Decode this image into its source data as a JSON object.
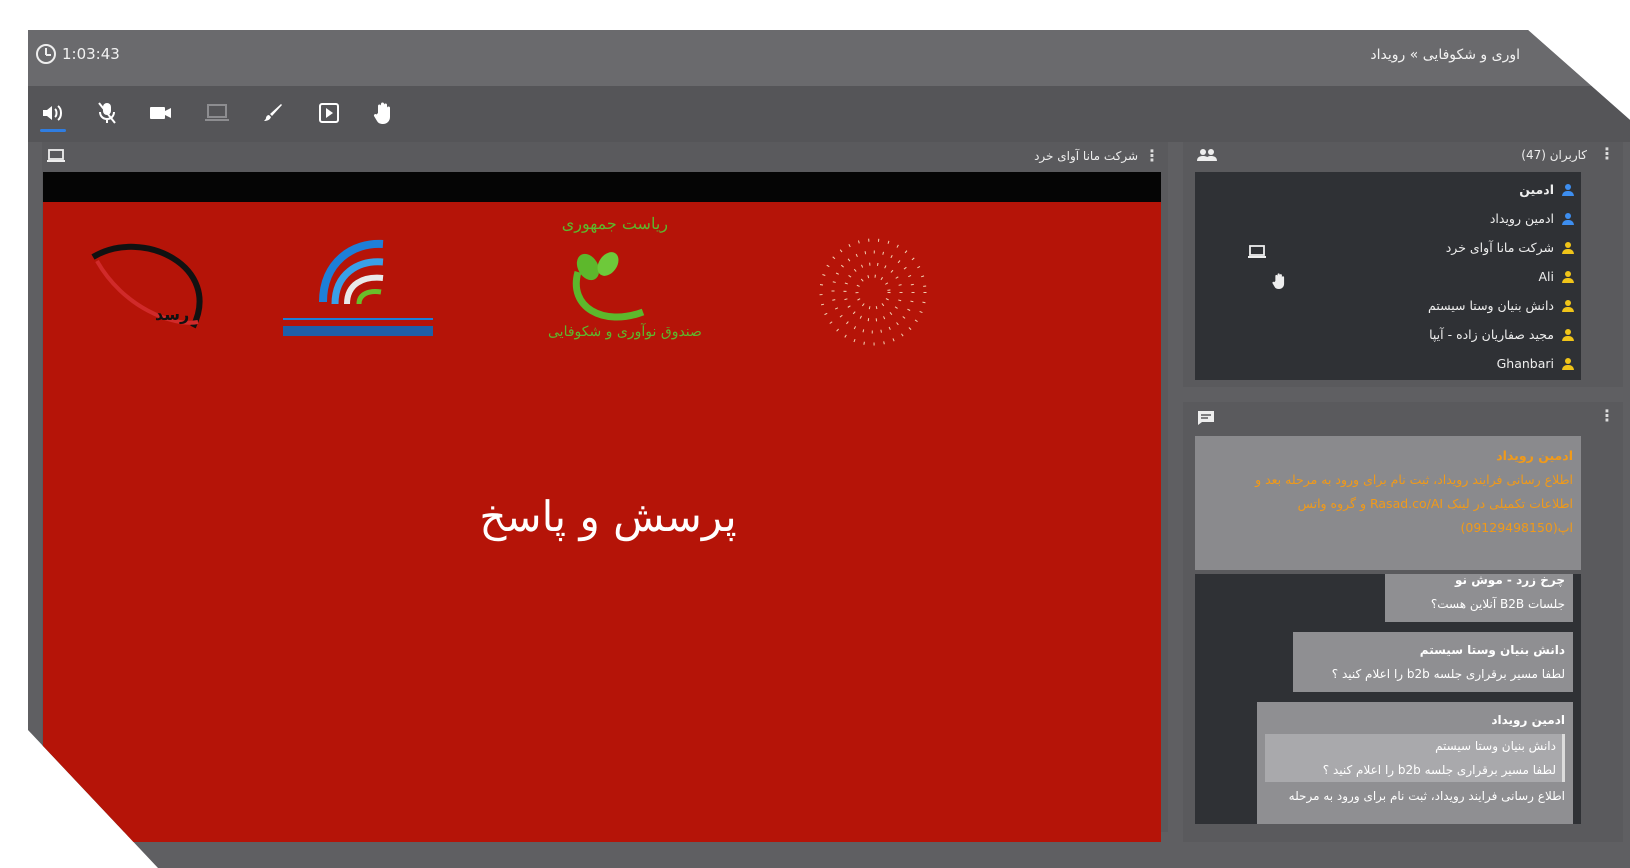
{
  "header": {
    "timer": "1:03:43",
    "breadcrumb": "اوری و شکوفایی » رویداد"
  },
  "toolbar": {
    "icons": [
      "speaker-icon",
      "mic-off-icon",
      "camera-icon",
      "screen-share-icon",
      "pen-icon",
      "presentation-icon",
      "raise-hand-icon"
    ]
  },
  "presentation": {
    "title": "شرکت مانا آوای خرد",
    "slide_text": "پرسش و پاسخ",
    "logos": {
      "rasad": "رسد",
      "fund": "صندوق نوآوری و شکوفایی",
      "presidency": "ریاست جمهوری"
    }
  },
  "users": {
    "title": "کاربران (47)",
    "list": [
      {
        "name": "ادمین",
        "color": "#3d8ef0"
      },
      {
        "name": "ادمین رویداد",
        "color": "#3d8ef0"
      },
      {
        "name": "شرکت مانا آوای خرد",
        "color": "#f0c419"
      },
      {
        "name": "Ali",
        "color": "#f0c419"
      },
      {
        "name": "دانش بنیان وستا سیستم",
        "color": "#f0c419"
      },
      {
        "name": "مجید صفاریان زاده - آیپا",
        "color": "#f0c419"
      },
      {
        "name": "Ghanbari",
        "color": "#f0c419"
      }
    ]
  },
  "chat": {
    "pinned": {
      "from": "ادمین رویداد",
      "line1": "اطلاع رسانی فرایند رویداد، ثبت نام برای ورود به مرحله بعد و",
      "line2": "اطلاعات تکمیلی در لینک Rasad.co/AI و گروه واتس اپ(09129498150)"
    },
    "messages": [
      {
        "from": "چرخ زرد - موش نو",
        "text": "جلسات B2B آنلاین هست؟"
      },
      {
        "from": "دانش بنیان وستا سیستم",
        "text": "لطفا مسیر برقراری جلسه b2b را اعلام کنید ؟"
      },
      {
        "from": "ادمین رویداد",
        "quote_from": "دانش بنیان وستا سیستم",
        "quote_text": "لطفا مسیر برقراری جلسه b2b را اعلام کنید ؟",
        "text": "اطلاع رسانی فرایند رویداد، ثبت نام برای ورود به مرحله"
      }
    ]
  },
  "colors": {
    "accent": "#2f7de1",
    "slide_bg": "#b51408",
    "pinned_text": "#f19a19"
  }
}
